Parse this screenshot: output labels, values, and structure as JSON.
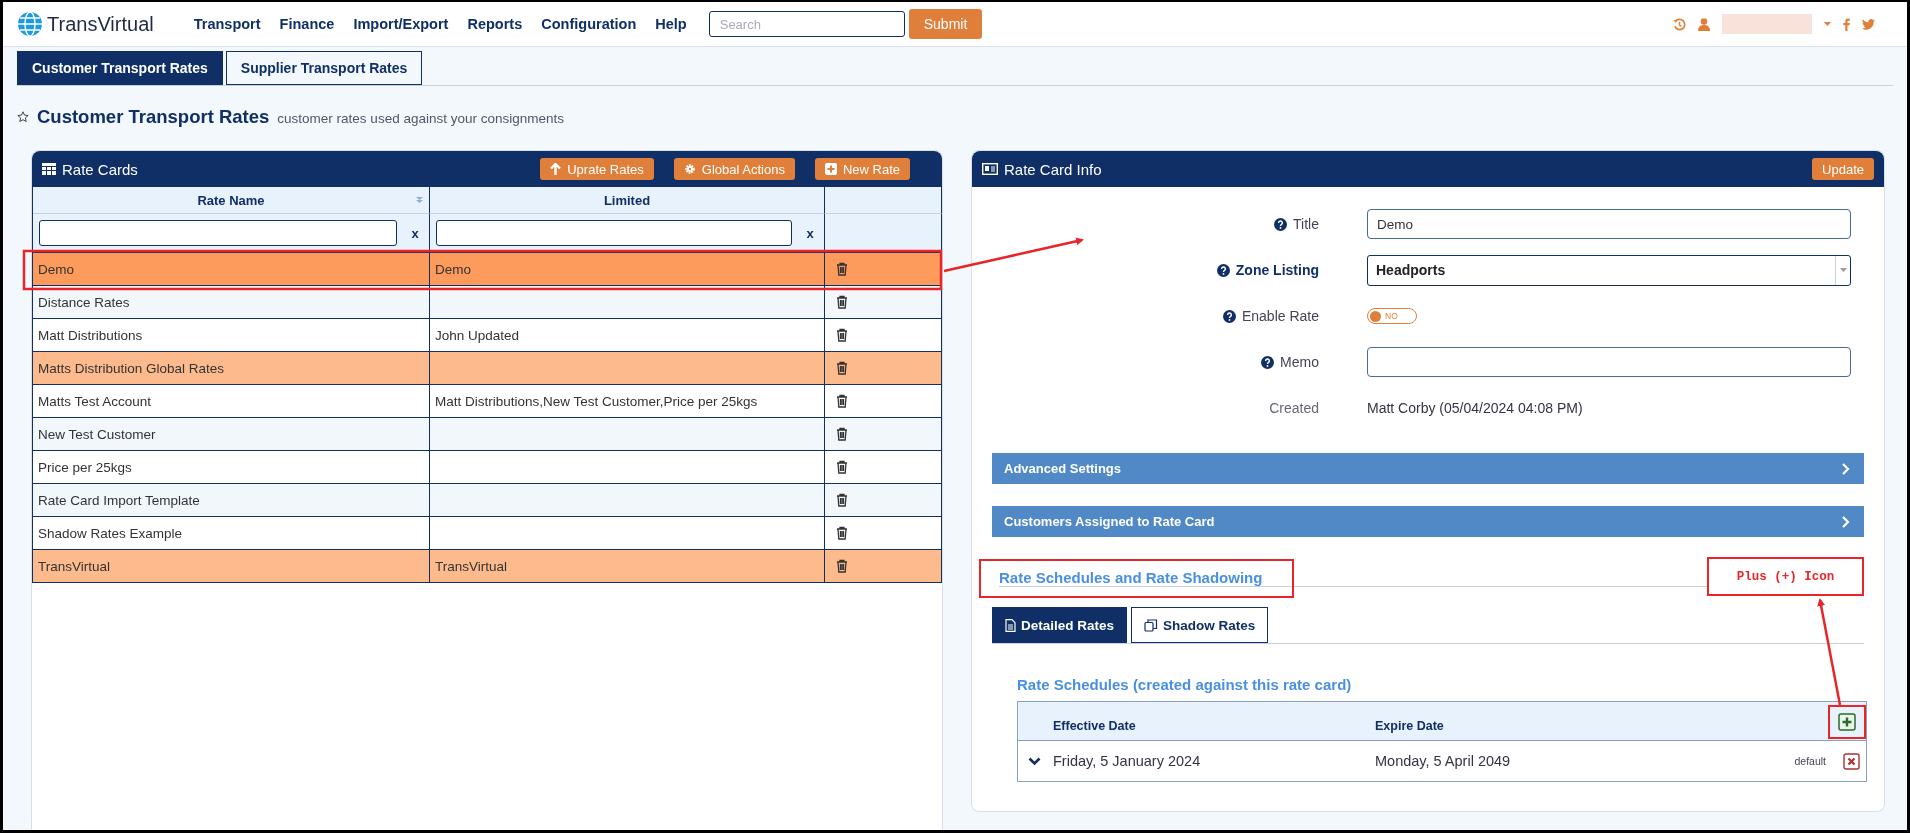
{
  "navbar": {
    "brand": "TransVirtual",
    "menu": [
      "Transport",
      "Finance",
      "Import/Export",
      "Reports",
      "Configuration",
      "Help"
    ],
    "search": {
      "placeholder": "Search"
    },
    "submit": "Submit"
  },
  "page_tabs": [
    {
      "label": "Customer Transport Rates",
      "selected": true
    },
    {
      "label": "Supplier Transport Rates",
      "selected": false
    }
  ],
  "page_heading": {
    "title": "Customer Transport Rates",
    "subtitle": "customer rates used against your consignments"
  },
  "rate_cards": {
    "title": "Rate Cards",
    "actions": [
      "Uprate Rates",
      "Global Actions",
      "New Rate"
    ],
    "columns": [
      {
        "label": "Rate Name",
        "sort_indicator": true,
        "clear": "x"
      },
      {
        "label": "Limited",
        "sort_indicator": false,
        "clear": "x"
      }
    ],
    "rows": [
      {
        "name": "Demo",
        "limited": "Demo",
        "selected": true,
        "highlighted": false
      },
      {
        "name": "Distance Rates",
        "limited": "",
        "selected": false,
        "highlighted": false
      },
      {
        "name": "Matt Distributions",
        "limited": "John Updated",
        "selected": false,
        "highlighted": false
      },
      {
        "name": "Matts Distribution Global Rates",
        "limited": "",
        "selected": false,
        "highlighted": true
      },
      {
        "name": "Matts Test Account",
        "limited": "Matt Distributions,New Test Customer,Price per 25kgs",
        "selected": false,
        "highlighted": false
      },
      {
        "name": "New Test Customer",
        "limited": "",
        "selected": false,
        "highlighted": false
      },
      {
        "name": "Price per 25kgs",
        "limited": "",
        "selected": false,
        "highlighted": false
      },
      {
        "name": "Rate Card Import Template",
        "limited": "",
        "selected": false,
        "highlighted": false
      },
      {
        "name": "Shadow Rates Example",
        "limited": "",
        "selected": false,
        "highlighted": false
      },
      {
        "name": "TransVirtual",
        "limited": "TransVirtual",
        "selected": false,
        "highlighted": true
      }
    ]
  },
  "rate_card_info": {
    "title": "Rate Card Info",
    "update": "Update",
    "fields": [
      {
        "kind": "text",
        "label": "Title",
        "value": "Demo"
      },
      {
        "kind": "select",
        "label": "Zone Listing",
        "value": "Headports"
      },
      {
        "kind": "toggle",
        "label": "Enable Rate",
        "on": false,
        "state_text": "NO"
      },
      {
        "kind": "text",
        "label": "Memo"
      },
      {
        "kind": "static",
        "label": "Created",
        "value": "Matt Corby (05/04/2024 04:08 PM)"
      }
    ],
    "sections": [
      {
        "title": "Advanced Settings"
      },
      {
        "title": "Customers Assigned to Rate Card"
      }
    ],
    "schedules": {
      "title": "Rate Schedules and Rate Shadowing",
      "tabs": [
        {
          "label": "Detailed Rates",
          "selected": true,
          "kind": "file"
        },
        {
          "label": "Shadow Rates",
          "selected": false,
          "kind": "copy"
        }
      ],
      "subtitle": "Rate Schedules (created against this rate card)",
      "columns": [
        "Effective Date",
        "Expire Date"
      ],
      "rows": [
        {
          "effective": "Friday, 5 January 2024",
          "expire": "Monday, 5 April 2049",
          "tag": "default"
        }
      ]
    }
  },
  "annotations": {
    "label": "Plus (+) Icon"
  }
}
